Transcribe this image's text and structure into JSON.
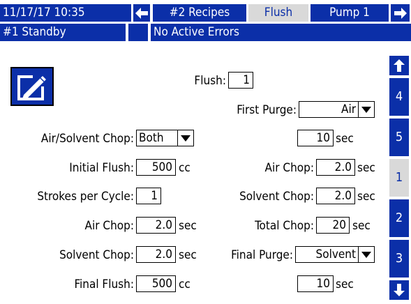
{
  "header": {
    "datetime": "11/17/17 10:35",
    "tabs": [
      {
        "label": "#2 Recipes",
        "active": false
      },
      {
        "label": "Flush",
        "active": true
      },
      {
        "label": "Pump 1",
        "active": false
      }
    ],
    "status": "#1 Standby",
    "errors": "No Active Errors"
  },
  "form": {
    "flush": {
      "label": "Flush:",
      "value": "1"
    },
    "first_purge": {
      "label": "First Purge:",
      "value": "Air"
    },
    "first_purge_time": {
      "value": "10",
      "unit": "sec"
    },
    "air_solvent_chop": {
      "label": "Air/Solvent Chop:",
      "value": "Both"
    },
    "initial_flush": {
      "label": "Initial Flush:",
      "value": "500",
      "unit": "cc"
    },
    "strokes_per_cycle": {
      "label": "Strokes per Cycle:",
      "value": "1"
    },
    "left_air_chop": {
      "label": "Air Chop:",
      "value": "2.0",
      "unit": "sec"
    },
    "left_solvent_chop": {
      "label": "Solvent Chop:",
      "value": "2.0",
      "unit": "sec"
    },
    "final_flush": {
      "label": "Final Flush:",
      "value": "500",
      "unit": "cc"
    },
    "right_air_chop": {
      "label": "Air Chop:",
      "value": "2.0",
      "unit": "sec"
    },
    "right_solvent_chop": {
      "label": "Solvent Chop:",
      "value": "2.0",
      "unit": "sec"
    },
    "total_chop": {
      "label": "Total Chop:",
      "value": "20",
      "unit": "sec"
    },
    "final_purge": {
      "label": "Final Purge:",
      "value": "Solvent"
    },
    "final_purge_time": {
      "value": "10",
      "unit": "sec"
    }
  },
  "side_tabs": [
    {
      "label": "4",
      "active": false
    },
    {
      "label": "5",
      "active": false
    },
    {
      "label": "1",
      "active": true
    },
    {
      "label": "2",
      "active": false
    },
    {
      "label": "3",
      "active": false
    }
  ],
  "colors": {
    "accent": "#0b2fa8",
    "active_tab": "#d9d9d9"
  }
}
